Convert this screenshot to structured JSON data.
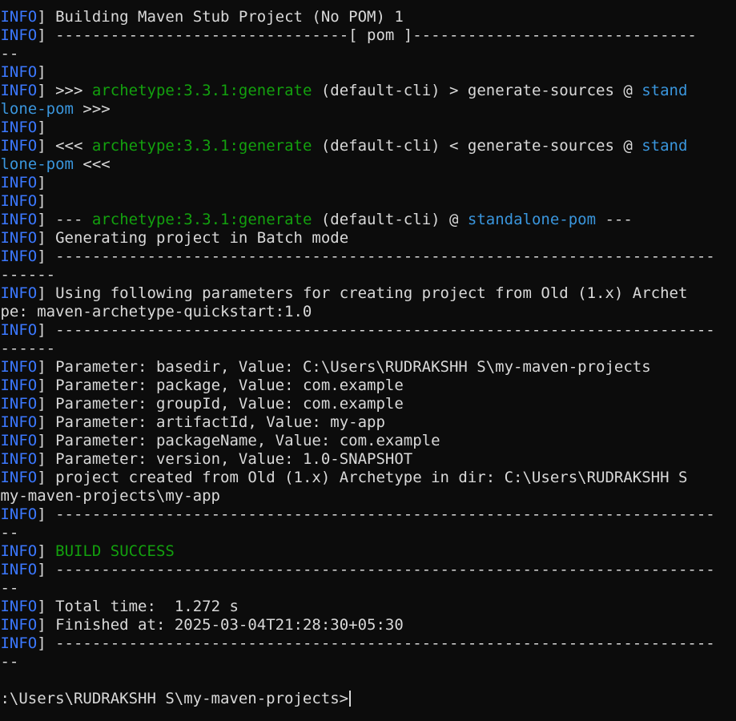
{
  "window": {
    "app": "Command Prompt",
    "colors": {
      "background": "#0c0c0c",
      "text": "#d9d9d9",
      "info_tag": "#3b78ff",
      "goal": "#13a10e",
      "project": "#3a96dd",
      "success": "#13a10e"
    }
  },
  "tag": {
    "open": "[",
    "level": "INFO",
    "close": "]"
  },
  "text": {
    "cut_top": "---",
    "building": " Building Maven Stub Project (No POM) 1",
    "pom_sep_a": " --------------------------------[ pom ]-------------------------------",
    "pom_sep_b": "---",
    "pre_gen": " >>> ",
    "goal": "archetype:3.3.1:generate",
    "gen_mid_pre": " (default-cli) > generate-sources @ ",
    "stand_a": "stand",
    "stand_b": "alone-pom",
    "pre_tail": " >>>",
    "post_gen": " <<< ",
    "gen_mid_post": " (default-cli) < generate-sources @ ",
    "post_tail": " <<<",
    "dash3": " --- ",
    "at_sep": " (default-cli) @ ",
    "project": "standalone-pom",
    "dash3_end": " ---",
    "batch": " Generating project in Batch mode",
    "rule_a": " ------------------------------------------------------------------------",
    "rule_b": "-------",
    "rule_c": "---",
    "using_a": " Using following parameters for creating project from Old (1.x) Archet",
    "using_b": "ype: maven-archetype-quickstart:1.0",
    "p_basedir": " Parameter: basedir, Value: C:\\Users\\RUDRAKSHH S\\my-maven-projects",
    "p_package": " Parameter: package, Value: com.example",
    "p_group": " Parameter: groupId, Value: com.example",
    "p_artifact": " Parameter: artifactId, Value: my-app",
    "p_pkgname": " Parameter: packageName, Value: com.example",
    "p_version": " Parameter: version, Value: 1.0-SNAPSHOT",
    "created_a": " project created from Old (1.x) Archetype in dir: C:\\Users\\RUDRAKSHH S",
    "created_b": "\\my-maven-projects\\my-app",
    "success": "BUILD SUCCESS",
    "total": " Total time:  1.272 s",
    "finished": " Finished at: 2025-03-04T21:28:30+05:30",
    "prompt": "C:\\Users\\RUDRAKSHH S\\my-maven-projects>"
  }
}
